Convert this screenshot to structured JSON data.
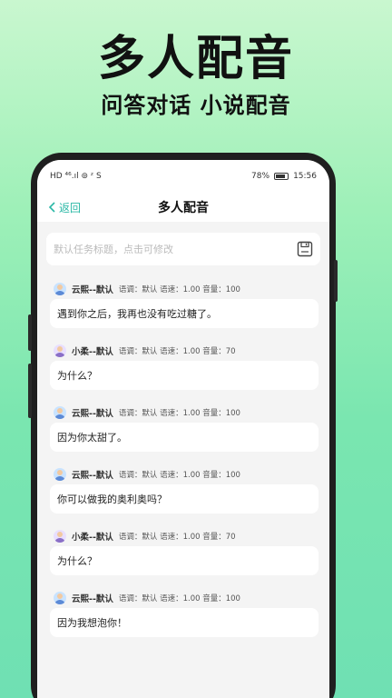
{
  "hero": {
    "title": "多人配音",
    "subtitle": "问答对话  小说配音"
  },
  "status_bar": {
    "left": "HD ⁴⁶.ıl ⊚ ᶻ S",
    "battery_pct": "78%",
    "time": "15:56"
  },
  "nav": {
    "back_label": "返回",
    "title": "多人配音"
  },
  "task": {
    "placeholder": "默认任务标题，点击可修改"
  },
  "dialogs": [
    {
      "speaker": "云熙--默认",
      "params": "语调：默认  语速：1.00  音量：100",
      "text": "遇到你之后，我再也没有吃过糖了。",
      "avatar": "male"
    },
    {
      "speaker": "小柔--默认",
      "params": "语调：默认  语速：1.00  音量：70",
      "text": "为什么？",
      "avatar": "female"
    },
    {
      "speaker": "云熙--默认",
      "params": "语调：默认  语速：1.00  音量：100",
      "text": "因为你太甜了。",
      "avatar": "male"
    },
    {
      "speaker": "云熙--默认",
      "params": "语调：默认  语速：1.00  音量：100",
      "text": "你可以做我的奥利奥吗？",
      "avatar": "male"
    },
    {
      "speaker": "小柔--默认",
      "params": "语调：默认  语速：1.00  音量：70",
      "text": "为什么？",
      "avatar": "female"
    },
    {
      "speaker": "云熙--默认",
      "params": "语调：默认  语速：1.00  音量：100",
      "text": "因为我想泡你！",
      "avatar": "male"
    }
  ],
  "colors": {
    "accent": "#2bb8a6",
    "background_top": "#c9f7cf",
    "background_bottom": "#6fe0b3"
  }
}
